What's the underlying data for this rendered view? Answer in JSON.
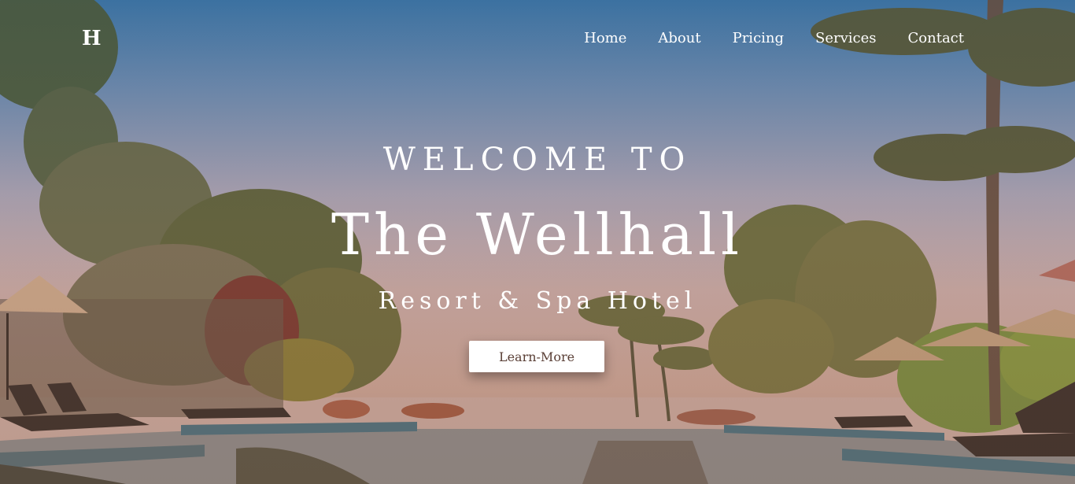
{
  "header": {
    "logo": "H",
    "nav": [
      "Home",
      "About",
      "Pricing",
      "Services",
      "Contact"
    ]
  },
  "hero": {
    "welcome": "WELCOME TO",
    "title": "The Wellhall",
    "subtitle": "Resort & Spa Hotel",
    "button": "Learn-More"
  },
  "colors": {
    "sky_top": "#3f77a6",
    "sky_bottom": "#c9a291",
    "button_bg": "#ffffff",
    "button_text": "#5a3f36"
  }
}
